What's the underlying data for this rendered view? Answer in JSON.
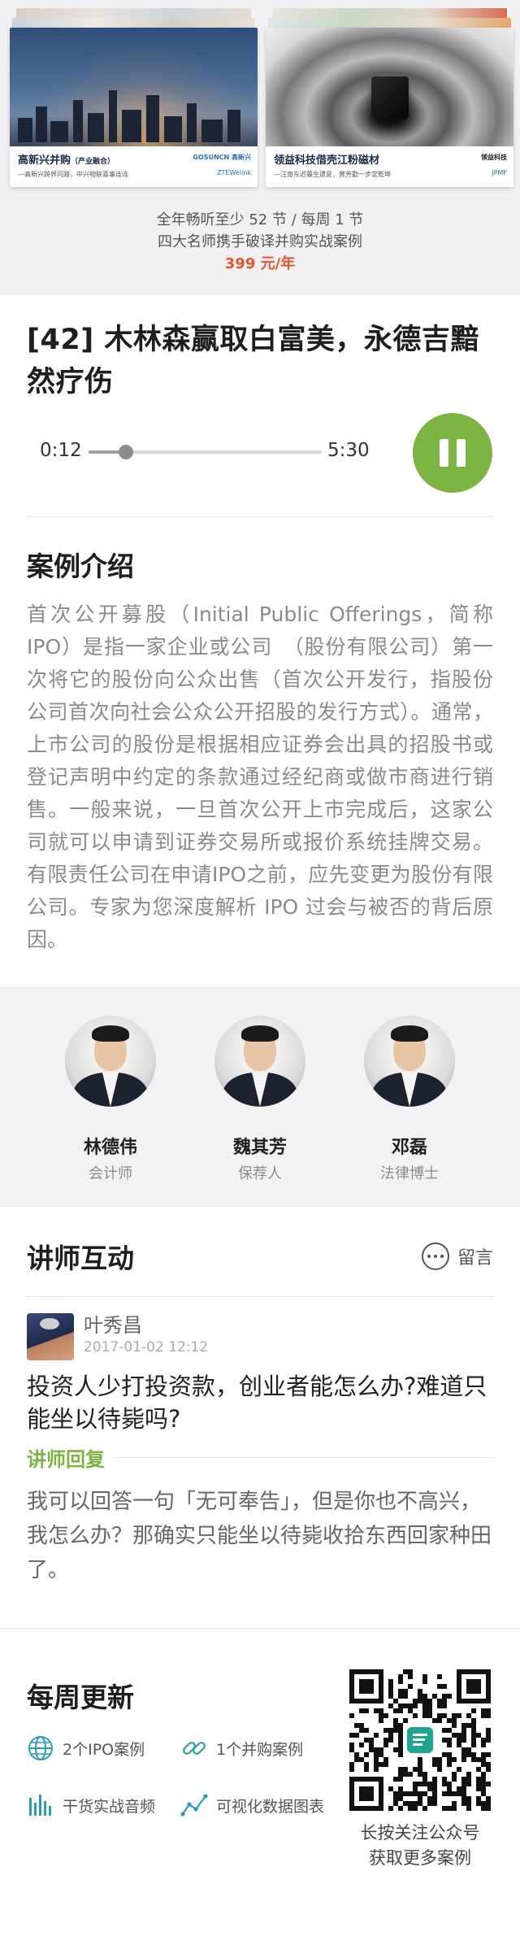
{
  "banner": {
    "card_left": {
      "title": "高新兴并购",
      "tag": "（产业融合）",
      "subtitle": "—高新兴跨界问路，中兴物联喜事连连",
      "logo_top": "GOSUNCN 高新兴",
      "logo_bottom": "ZTEWelink"
    },
    "card_right": {
      "title": "领益科技借壳江粉磁材",
      "subtitle": "—汪南东迟暮生遗意，曾芳勤一步定乾坤",
      "logo_top": "领益科技",
      "logo_bottom": "JPMF"
    },
    "line1": "全年畅听至少 52 节 / 每周 1 节",
    "line2": "四大名师携手破译并购实战案例",
    "price": "399 元/年"
  },
  "episode": {
    "title": "[42] 木林森赢取白富美，永德吉黯然疗伤",
    "current_time": "0:12",
    "total_time": "5:30",
    "progress": 0.16,
    "state": "playing",
    "accent_color": "#7cb342"
  },
  "intro": {
    "title": "案例介绍",
    "text": "首次公开募股（Initial Public Offerings，简称IPO）是指一家企业或公司　（股份有限公司）第一次将它的股份向公众出售（首次公开发行，指股份公司首次向社会公众公开招股的发行方式）。通常，上市公司的股份是根据相应证券会出具的招股书或登记声明中约定的条款通过经纪商或做市商进行销售。一般来说，一旦首次公开上市完成后，这家公司就可以申请到证券交易所或报价系统挂牌交易。有限责任公司在申请IPO之前，应先变更为股份有限公司。专家为您深度解析 IPO 过会与被否的背后原因。"
  },
  "teachers": [
    {
      "name": "林德伟",
      "role": "会计师"
    },
    {
      "name": "魏其芳",
      "role": "保荐人"
    },
    {
      "name": "邓磊",
      "role": "法律博士"
    }
  ],
  "interaction": {
    "title": "讲师互动",
    "message_label": "留言",
    "comment": {
      "user": "叶秀昌",
      "time": "2017-01-02 12:12",
      "text": "投资人少打投资款，创业者能怎么办?难道只能坐以待毙吗?"
    },
    "reply_label": "讲师回复",
    "reply_text": "我可以回答一句「无可奉告」，但是你也不高兴，我怎么办？那确实只能坐以待毙收拾东西回家种田了。"
  },
  "weekly": {
    "title": "每周更新",
    "features": [
      {
        "icon": "globe-icon",
        "label": "2个IPO案例"
      },
      {
        "icon": "link-icon",
        "label": "1个并购案例"
      },
      {
        "icon": "audio-bars-icon",
        "label": "干货实战音频"
      },
      {
        "icon": "line-chart-icon",
        "label": "可视化数据图表"
      }
    ],
    "qr_line1": "长按关注公众号",
    "qr_line2": "获取更多案例",
    "icon_color": "#2a9db5"
  }
}
